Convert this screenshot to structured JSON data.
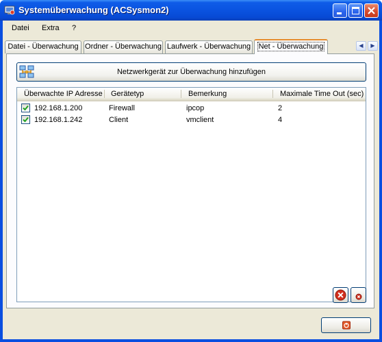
{
  "window": {
    "title": "Systemüberwachung (ACSysmon2)",
    "controls": [
      "minimize",
      "maximize",
      "close"
    ]
  },
  "menu": {
    "items": [
      "Datei",
      "Extra",
      "?"
    ]
  },
  "tabs": {
    "items": [
      {
        "label": "Datei - Überwachung",
        "active": false
      },
      {
        "label": "Ordner - Überwachung",
        "active": false
      },
      {
        "label": "Laufwerk - Überwachung",
        "active": false
      },
      {
        "label": "Net - Überwachung",
        "active": true
      }
    ]
  },
  "net": {
    "add_button_label": "Netzwerkgerät zur Überwachung hinzufügen",
    "columns": [
      "Überwachte IP Adresse",
      "Gerätetyp",
      "Bemerkung",
      "Maximale Time Out (sec)"
    ],
    "rows": [
      {
        "checked": true,
        "ip": "192.168.1.200",
        "type": "Firewall",
        "note": "ipcop",
        "timeout": "2"
      },
      {
        "checked": true,
        "ip": "192.168.1.242",
        "type": "Client",
        "note": "vmclient",
        "timeout": "4"
      }
    ],
    "action_icons": [
      "delete-all-icon",
      "delete-icon"
    ]
  },
  "footer": {
    "close_icon": "power-off-icon"
  },
  "colors": {
    "titlebar": "#0a53e0",
    "active_tab_accent": "#e68b2c",
    "dialog_bg": "#ece9d8",
    "check": "#21a121",
    "delete_red": "#d32f1e"
  }
}
